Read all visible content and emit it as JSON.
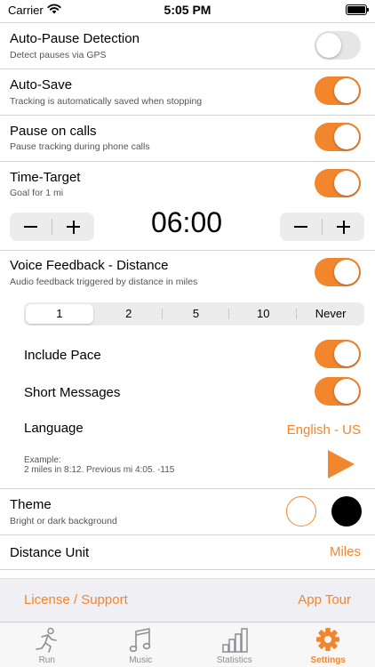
{
  "status_bar": {
    "carrier": "Carrier",
    "time": "5:05 PM"
  },
  "settings": {
    "auto_pause": {
      "title": "Auto-Pause Detection",
      "subtitle": "Detect pauses via GPS",
      "enabled": false
    },
    "auto_save": {
      "title": "Auto-Save",
      "subtitle": "Tracking is automatically saved when stopping",
      "enabled": true
    },
    "pause_calls": {
      "title": "Pause on calls",
      "subtitle": "Pause tracking during phone calls",
      "enabled": true
    },
    "time_target": {
      "title": "Time-Target",
      "subtitle": "Goal for 1 mi",
      "enabled": true,
      "value": "06:00"
    },
    "voice_feedback": {
      "title": "Voice Feedback - Distance",
      "subtitle": "Audio feedback triggered by distance in miles",
      "enabled": true,
      "segments": [
        "1",
        "2",
        "5",
        "10",
        "Never"
      ],
      "selected_segment": "1",
      "include_pace": {
        "label": "Include Pace",
        "enabled": true
      },
      "short_messages": {
        "label": "Short Messages",
        "enabled": true
      },
      "language": {
        "label": "Language",
        "value": "English - US"
      },
      "example_label": "Example:",
      "example_text": "2 miles in 8:12. Previous mi 4:05. -115"
    },
    "theme": {
      "title": "Theme",
      "subtitle": "Bright or dark background",
      "selected": "light"
    },
    "distance_unit": {
      "title": "Distance Unit",
      "value": "Miles"
    }
  },
  "footer": {
    "license_label": "License / Support",
    "tour_label": "App Tour"
  },
  "tabs": [
    {
      "label": "Run",
      "icon": "runner-icon",
      "active": false
    },
    {
      "label": "Music",
      "icon": "music-note-icon",
      "active": false
    },
    {
      "label": "Statistics",
      "icon": "bar-chart-icon",
      "active": false
    },
    {
      "label": "Settings",
      "icon": "gear-icon",
      "active": true
    }
  ],
  "colors": {
    "accent": "#f2862d",
    "toggle_off": "#e6e6e6",
    "inactive_tab": "#8e8e93"
  }
}
